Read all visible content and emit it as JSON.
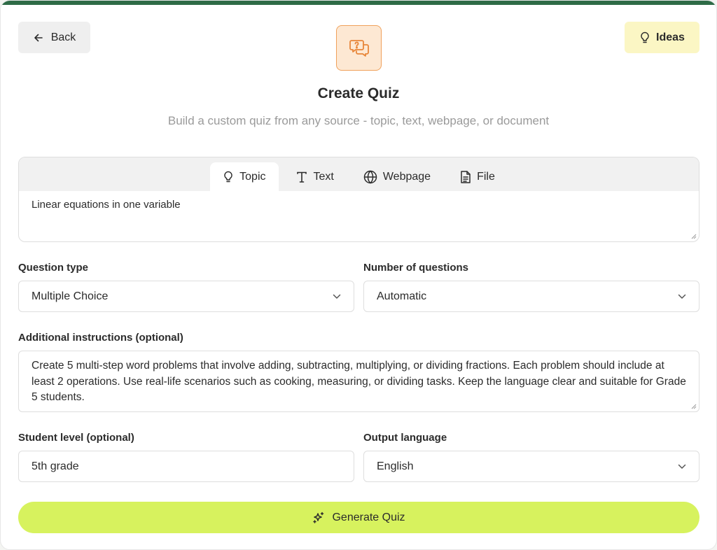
{
  "header": {
    "back_label": "Back",
    "ideas_label": "Ideas",
    "title": "Create Quiz",
    "subtitle": "Build a custom quiz from any source - topic, text, webpage, or document"
  },
  "source_tabs": {
    "items": [
      {
        "label": "Topic",
        "icon": "lightbulb-icon",
        "active": true
      },
      {
        "label": "Text",
        "icon": "text-icon",
        "active": false
      },
      {
        "label": "Webpage",
        "icon": "globe-icon",
        "active": false
      },
      {
        "label": "File",
        "icon": "document-icon",
        "active": false
      }
    ],
    "topic_value": "Linear equations in one variable"
  },
  "form": {
    "question_type_label": "Question type",
    "question_type_value": "Multiple Choice",
    "num_questions_label": "Number of questions",
    "num_questions_value": "Automatic",
    "instructions_label": "Additional instructions (optional)",
    "instructions_value": "Create 5 multi-step word problems that involve adding, subtracting, multiplying, or dividing fractions. Each problem should include at least 2 operations. Use real-life scenarios such as cooking, measuring, or dividing tasks. Keep the language clear and suitable for Grade 5 students.",
    "student_level_label": "Student level (optional)",
    "student_level_value": "5th grade",
    "output_language_label": "Output language",
    "output_language_value": "English"
  },
  "generate_label": "Generate Quiz",
  "colors": {
    "top_bar": "#2e6b46",
    "ideas_bg": "#fbf6c4",
    "logo_bg": "#fde8d3",
    "logo_border": "#f0a15b",
    "generate_bg": "#d7f25e"
  }
}
